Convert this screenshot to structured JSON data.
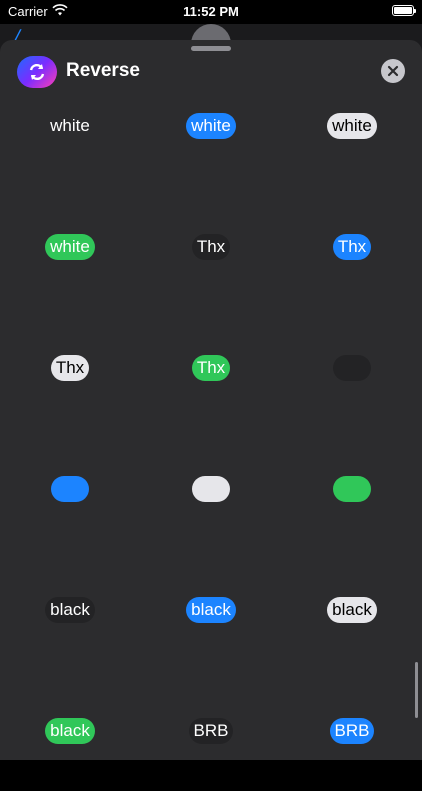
{
  "status_bar": {
    "carrier": "Carrier",
    "time": "11:52 PM"
  },
  "header": {
    "title": "Reverse",
    "app_icon": "reverse-arrows-icon",
    "close_icon": "close-icon"
  },
  "grid": {
    "rows": [
      [
        {
          "text": "white",
          "style": "plain"
        },
        {
          "text": "white",
          "style": "blue"
        },
        {
          "text": "white",
          "style": "light"
        }
      ],
      [
        {
          "text": "white",
          "style": "green"
        },
        {
          "text": "Thx",
          "style": "dark"
        },
        {
          "text": "Thx",
          "style": "blue"
        }
      ],
      [
        {
          "text": "Thx",
          "style": "light"
        },
        {
          "text": "Thx",
          "style": "green"
        },
        {
          "text": "",
          "style": "dark"
        }
      ],
      [
        {
          "text": "",
          "style": "blue"
        },
        {
          "text": "",
          "style": "light"
        },
        {
          "text": "",
          "style": "green"
        }
      ],
      [
        {
          "text": "black",
          "style": "dark"
        },
        {
          "text": "black",
          "style": "blue"
        },
        {
          "text": "black",
          "style": "light"
        }
      ],
      [
        {
          "text": "black",
          "style": "green"
        },
        {
          "text": "BRB",
          "style": "dark"
        },
        {
          "text": "BRB",
          "style": "blue"
        }
      ]
    ]
  },
  "colors": {
    "sheet_background": "#2c2c2e",
    "blue": "#1c84ff",
    "green": "#30c759",
    "light": "#e6e6ea",
    "dark": "#232325"
  }
}
